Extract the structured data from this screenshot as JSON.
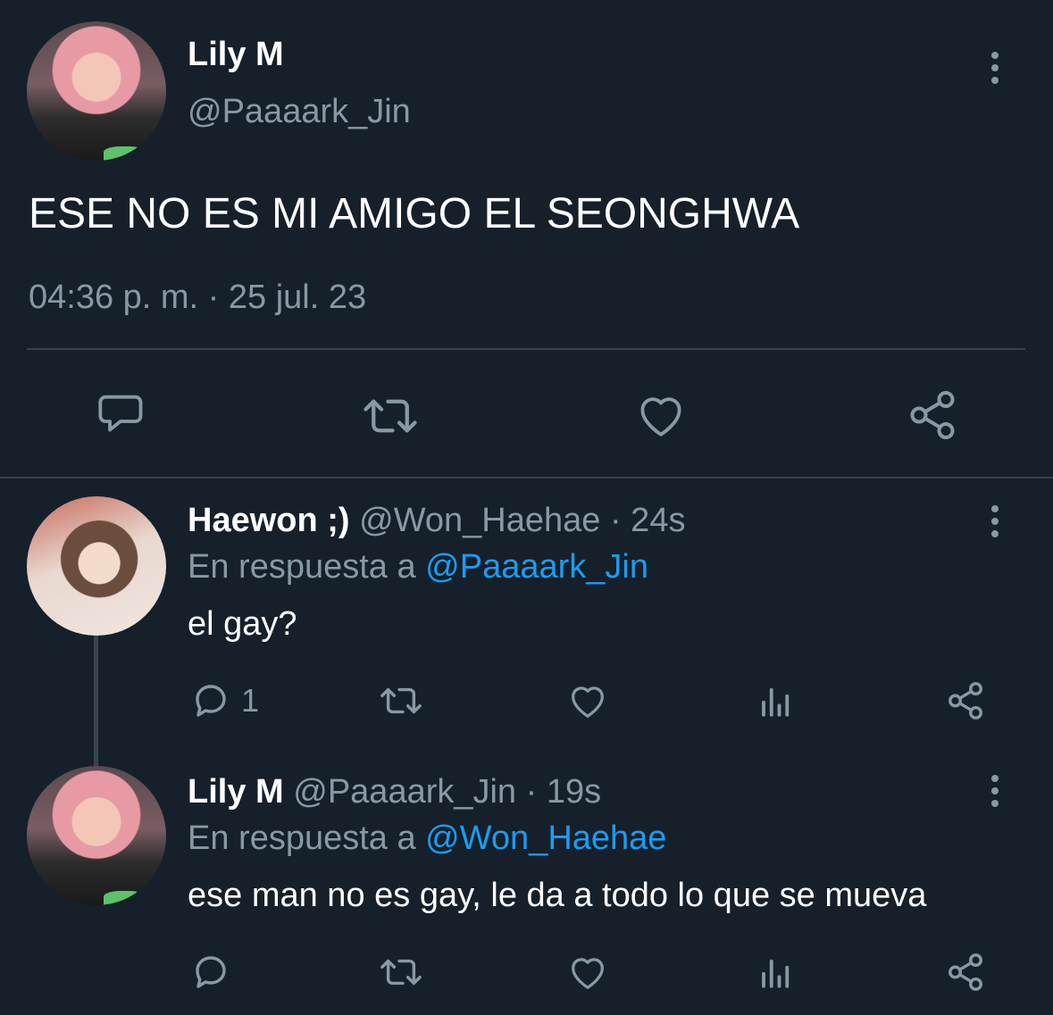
{
  "main_tweet": {
    "display_name": "Lily M",
    "handle": "@Paaaark_Jin",
    "text": "ESE NO ES MI AMIGO EL SEONGHWA",
    "timestamp": "04:36 p. m. · 25 jul. 23",
    "actions": [
      "reply-icon",
      "retweet-icon",
      "like-icon",
      "share-icon"
    ]
  },
  "replies": [
    {
      "display_name": "Haewon ;)",
      "handle": "@Won_Haehae",
      "time": "· 24s",
      "reply_prefix": "En respuesta a",
      "reply_to": "@Paaaark_Jin",
      "text": "el gay?",
      "reply_count": "1"
    },
    {
      "display_name": "Lily M",
      "handle": "@Paaaark_Jin",
      "time": "· 19s",
      "reply_prefix": "En respuesta a",
      "reply_to": "@Won_Haehae",
      "text": "ese man no es gay, le da a todo lo que se mueva",
      "reply_count": ""
    }
  ],
  "colors": {
    "background": "#15202b",
    "muted": "#8899a6",
    "link": "#1d9bf0",
    "divider": "#38444d"
  }
}
